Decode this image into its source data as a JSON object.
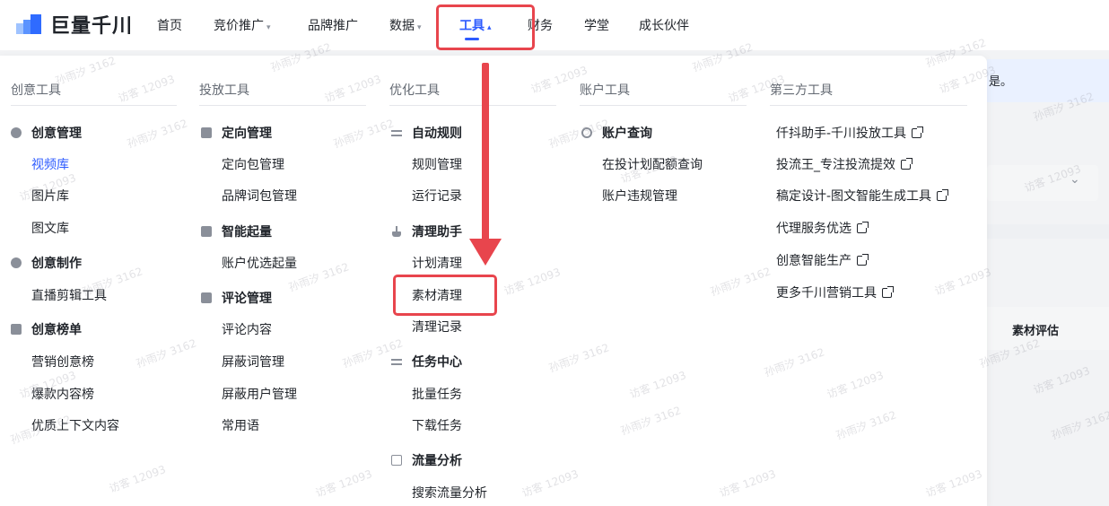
{
  "brand": {
    "name": "巨量千川"
  },
  "nav": {
    "items": [
      {
        "label": "首页",
        "caret": ""
      },
      {
        "label": "竞价推广",
        "caret": "▾"
      },
      {
        "label": "品牌推广",
        "caret": ""
      },
      {
        "label": "数据",
        "caret": "▾"
      },
      {
        "label": "工具",
        "caret": "▴"
      },
      {
        "label": "财务",
        "caret": ""
      },
      {
        "label": "学堂",
        "caret": ""
      },
      {
        "label": "成长伙伴",
        "caret": ""
      }
    ],
    "active_index": 4
  },
  "background": {
    "banner_text": "是。",
    "table_header": "素材评估",
    "select_caret": "⌄"
  },
  "menu": {
    "creative": {
      "title": "创意工具",
      "groups": [
        {
          "label": "创意管理",
          "icon": "bulb-icon"
        },
        {
          "label": "创意制作",
          "icon": "bulb-icon"
        },
        {
          "label": "创意榜单",
          "icon": "ranking-icon"
        }
      ],
      "items": [
        "视频库",
        "图片库",
        "图文库",
        "直播剪辑工具",
        "营销创意榜",
        "爆款内容榜",
        "优质上下文内容"
      ]
    },
    "delivery": {
      "title": "投放工具",
      "groups": [
        {
          "label": "定向管理",
          "icon": "target-icon"
        },
        {
          "label": "智能起量",
          "icon": "trend-icon"
        },
        {
          "label": "评论管理",
          "icon": "comment-icon"
        }
      ],
      "items": [
        "定向包管理",
        "品牌词包管理",
        "账户优选起量",
        "评论内容",
        "屏蔽词管理",
        "屏蔽用户管理",
        "常用语"
      ]
    },
    "optimize": {
      "title": "优化工具",
      "groups": [
        {
          "label": "自动规则",
          "icon": "rules-icon"
        },
        {
          "label": "清理助手",
          "icon": "broom-icon"
        },
        {
          "label": "任务中心",
          "icon": "task-icon"
        },
        {
          "label": "流量分析",
          "icon": "chart-icon"
        }
      ],
      "items": [
        "规则管理",
        "运行记录",
        "计划清理",
        "素材清理",
        "清理记录",
        "批量任务",
        "下载任务",
        "搜索流量分析"
      ]
    },
    "account": {
      "title": "账户工具",
      "groups": [
        {
          "label": "账户查询",
          "icon": "search-ring-icon"
        }
      ],
      "items": [
        "在投计划配额查询",
        "账户违规管理"
      ]
    },
    "third_party": {
      "title": "第三方工具",
      "items": [
        "仟抖助手-千川投放工具",
        "投流王_专注投流提效",
        "稿定设计-图文智能生成工具",
        "代理服务优选",
        "创意智能生产",
        "更多千川营销工具"
      ]
    }
  },
  "watermarks": [
    "孙雨汐 3162",
    "访客 12093"
  ],
  "colors": {
    "accent": "#2d5bff",
    "annotation_red": "#e8454d",
    "muted": "#646a73"
  }
}
